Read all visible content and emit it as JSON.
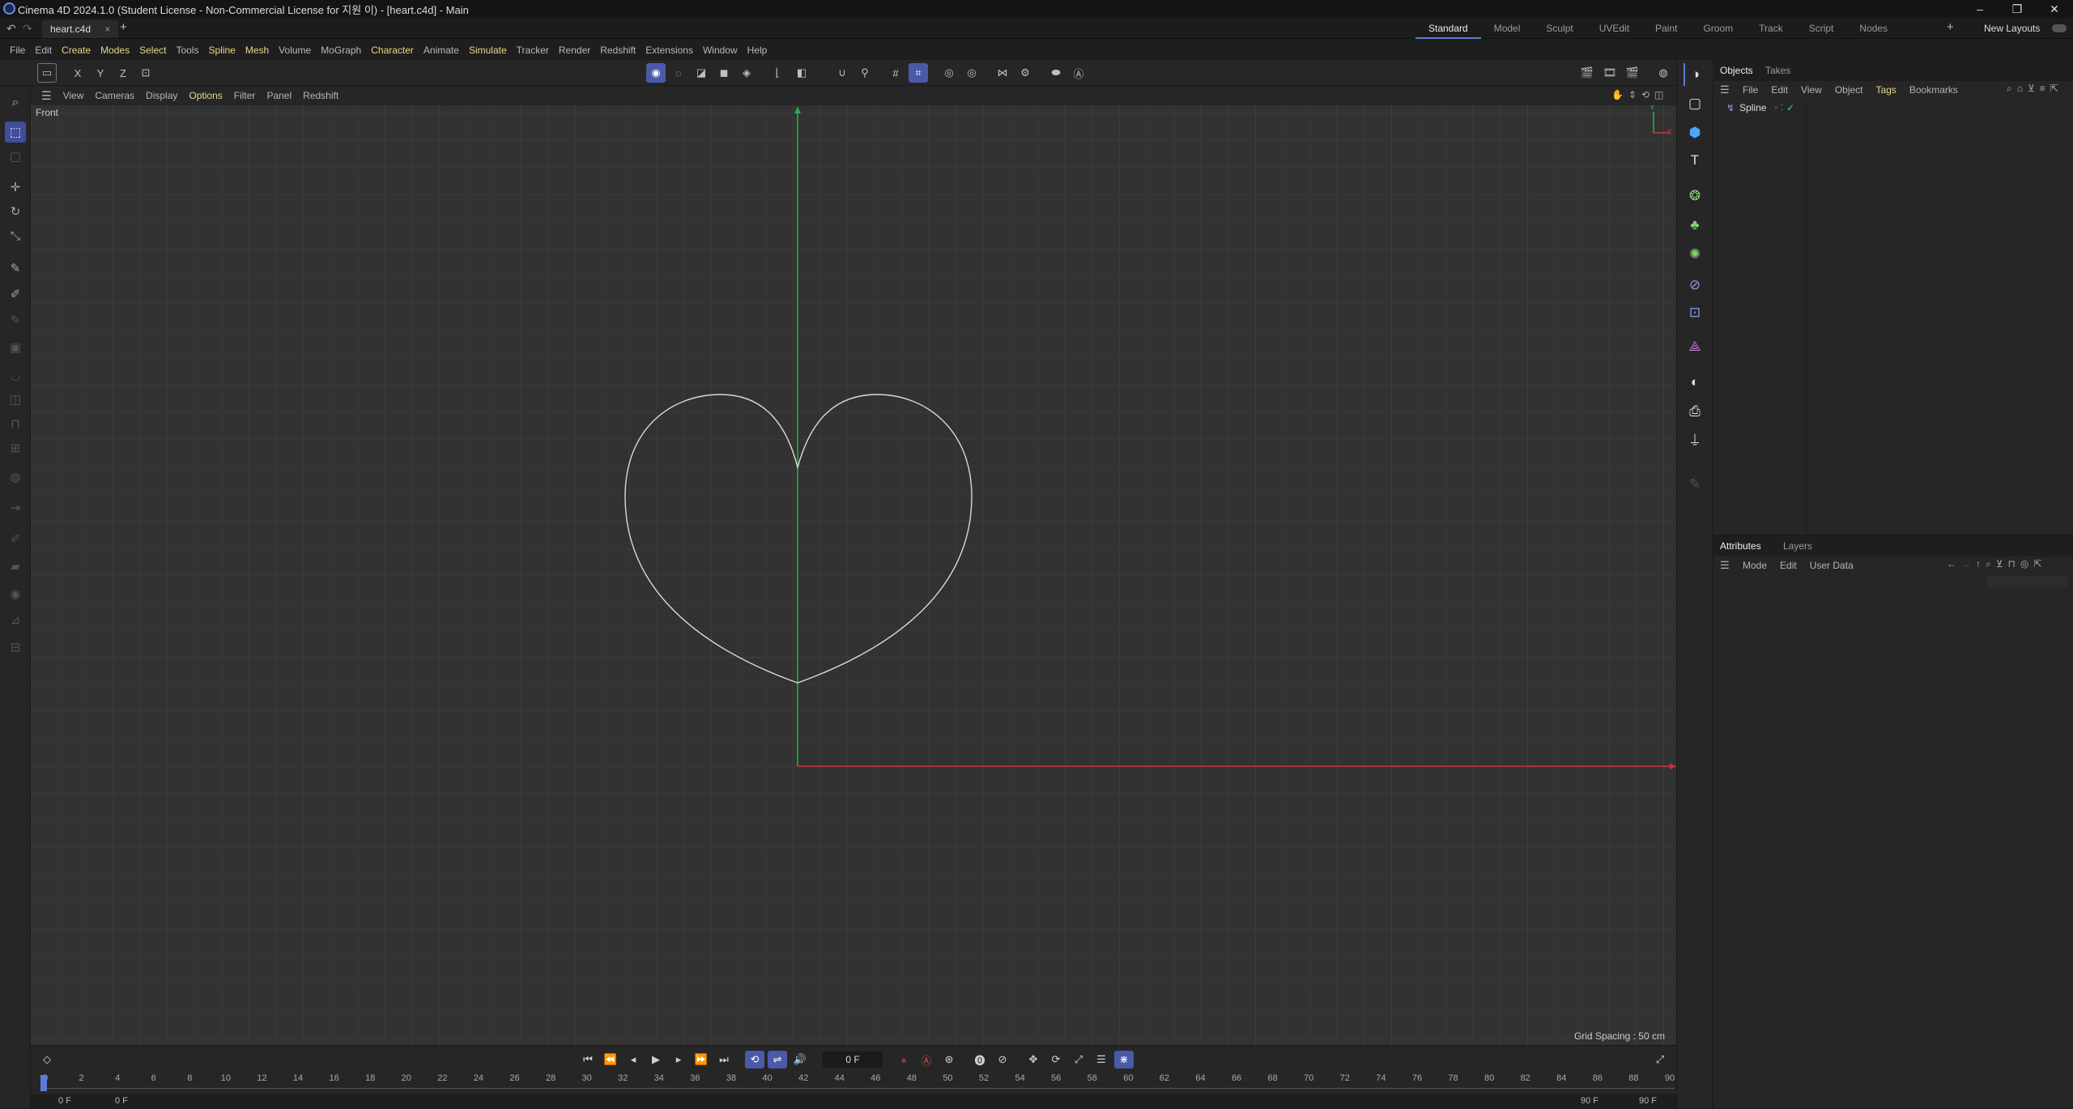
{
  "window": {
    "title": "Cinema 4D 2024.1.0 (Student License - Non-Commercial License for 지원 이) - [heart.c4d] - Main",
    "minimize": "–",
    "maximize": "❐",
    "close": "✕"
  },
  "tabs": {
    "doc_tab": "heart.c4d",
    "doc_close": "×",
    "new_tab": "+"
  },
  "layouts": {
    "items": [
      "Standard",
      "Model",
      "Sculpt",
      "UVEdit",
      "Paint",
      "Groom",
      "Track",
      "Script",
      "Nodes"
    ],
    "add": "+",
    "new_layouts": "New Layouts"
  },
  "menu": [
    "File",
    "Edit",
    "Create",
    "Modes",
    "Select",
    "Tools",
    "Spline",
    "Mesh",
    "Volume",
    "MoGraph",
    "Character",
    "Animate",
    "Simulate",
    "Tracker",
    "Render",
    "Redshift",
    "Extensions",
    "Window",
    "Help"
  ],
  "axis_toggles": [
    "X",
    "Y",
    "Z"
  ],
  "viewport": {
    "menu": [
      "View",
      "Cameras",
      "Display",
      "Options",
      "Filter",
      "Panel",
      "Redshift"
    ],
    "label": "Front",
    "grid_spacing": "Grid Spacing : 50 cm",
    "axis_y": "Y",
    "axis_x": "X",
    "colors": {
      "y_axis": "#22b14c",
      "x_axis": "#c8323c",
      "spline": "#d8d8d8"
    }
  },
  "objects_panel": {
    "tabs": [
      "Objects",
      "Takes"
    ],
    "menu": [
      "File",
      "Edit",
      "View",
      "Object",
      "Tags",
      "Bookmarks"
    ],
    "items": [
      {
        "name": "Spline"
      }
    ]
  },
  "attributes_panel": {
    "tabs": [
      "Attributes",
      "Layers"
    ],
    "menu": [
      "Mode",
      "Edit",
      "User Data"
    ]
  },
  "timeline": {
    "current_frame": "0 F",
    "ruler_labels": [
      "0",
      "2",
      "4",
      "6",
      "8",
      "10",
      "12",
      "14",
      "16",
      "18",
      "20",
      "22",
      "24",
      "26",
      "28",
      "30",
      "32",
      "34",
      "36",
      "38",
      "40",
      "42",
      "44",
      "46",
      "48",
      "50",
      "52",
      "54",
      "56",
      "58",
      "60",
      "62",
      "64",
      "66",
      "68",
      "70",
      "72",
      "74",
      "76",
      "78",
      "80",
      "82",
      "84",
      "86",
      "88",
      "90"
    ],
    "start_min": "0 F",
    "start": "0 F",
    "end": "90 F",
    "end_max": "90 F"
  }
}
